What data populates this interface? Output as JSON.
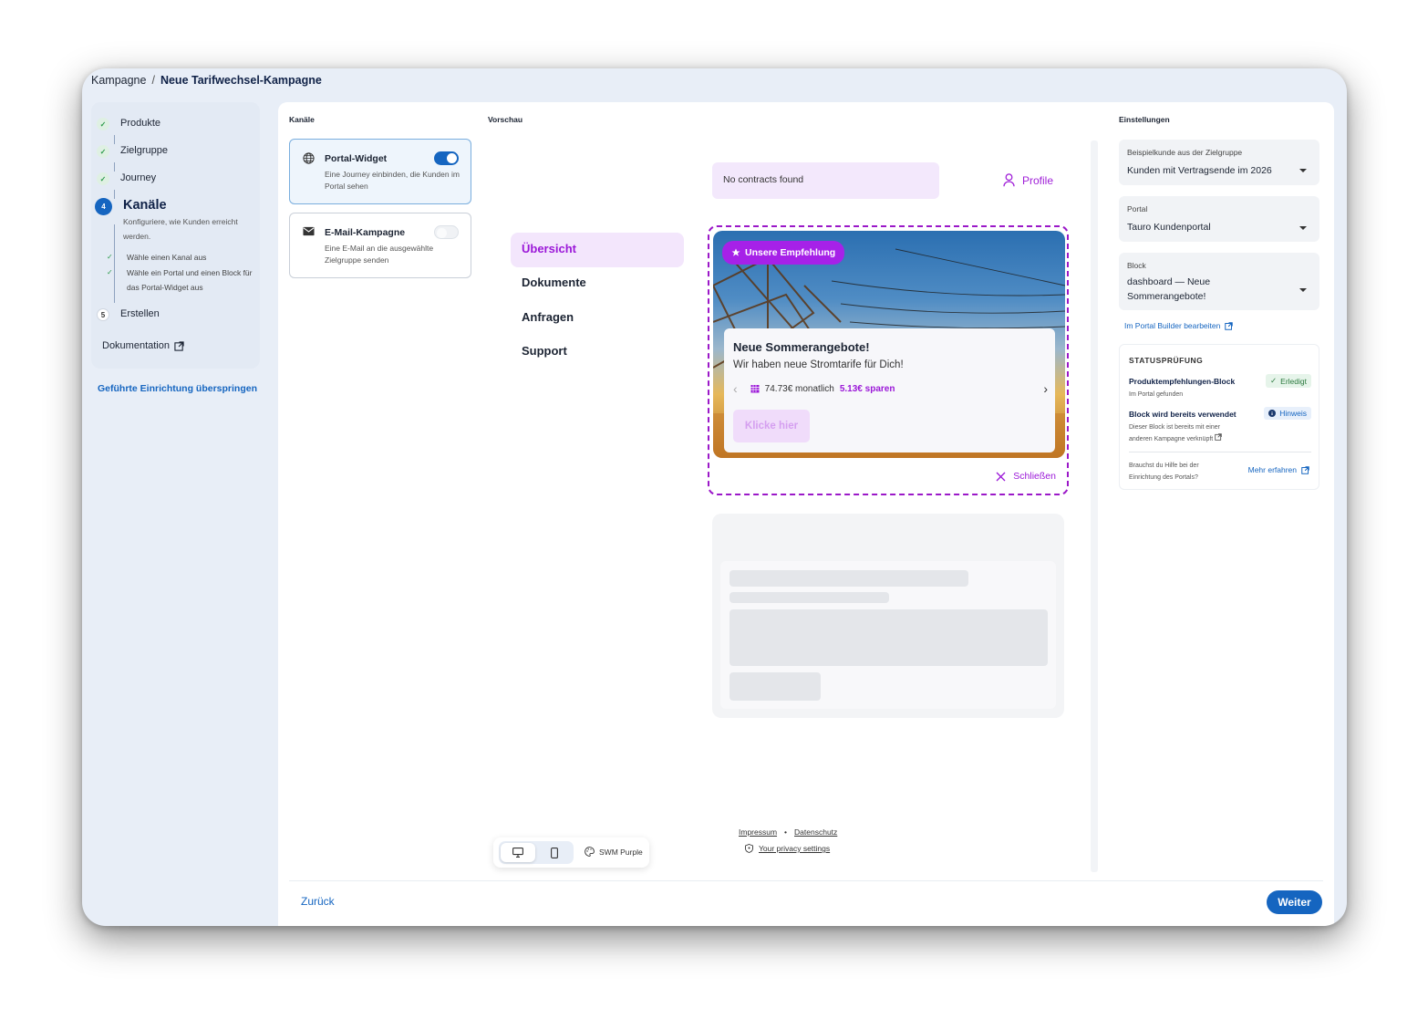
{
  "breadcrumb": {
    "parent": "Kampagne",
    "separator": "/",
    "current": "Neue Tarifwechsel-Kampagne"
  },
  "stepper": {
    "steps": [
      {
        "label": "Produkte"
      },
      {
        "label": "Zielgruppe"
      },
      {
        "label": "Journey"
      },
      {
        "number": "4",
        "label": "Kanäle",
        "description": "Konfiguriere, wie Kunden erreicht werden."
      },
      {
        "number": "5",
        "label": "Erstellen"
      }
    ],
    "substeps": [
      {
        "label": "Wähle einen Kanal aus"
      },
      {
        "label": "Wähle ein Portal und einen Block für das Portal-Widget aus"
      }
    ],
    "documentation": "Dokumentation",
    "skip": "Geführte Einrichtung überspringen"
  },
  "channels": {
    "heading": "Kanäle",
    "items": [
      {
        "title": "Portal-Widget",
        "text": "Eine Journey einbinden, die Kunden im Portal sehen",
        "enabled": true,
        "icon": "globe-icon"
      },
      {
        "title": "E-Mail-Kampagne",
        "text": "Eine E-Mail an die ausgewählte Zielgruppe senden",
        "enabled": false,
        "icon": "mail-icon"
      }
    ]
  },
  "preview": {
    "heading": "Vorschau",
    "contracts": "No contracts found",
    "profile": "Profile",
    "nav": [
      "Übersicht",
      "Dokumente",
      "Anfragen",
      "Support"
    ],
    "widget": {
      "badge": "Unsere Empfehlung",
      "title": "Neue Sommerangebote!",
      "subtitle": "Wir haben neue Stromtarife für Dich!",
      "price": "74.73€ monatlich",
      "saving": "5.13€ sparen",
      "cta": "Klicke hier",
      "close": "Schließen"
    },
    "footer": {
      "impressum": "Impressum",
      "dot": "•",
      "datenschutz": "Datenschutz",
      "privacy": "Your privacy settings"
    },
    "theme": "SWM Purple"
  },
  "settings": {
    "heading": "Einstellungen",
    "customer": {
      "caption": "Beispielkunde aus der Zielgruppe",
      "value": "Kunden mit Vertragsende im 2026"
    },
    "portal": {
      "caption": "Portal",
      "value": "Tauro Kundenportal"
    },
    "block": {
      "caption": "Block",
      "value": "dashboard — Neue Sommerangebote!"
    },
    "builder_link": "Im Portal Builder bearbeiten",
    "status": {
      "title": "STATUSPRÜFUNG",
      "items": [
        {
          "name": "Produktempfehlungen-Block",
          "desc": "Im Portal gefunden",
          "badge": "Erledigt"
        },
        {
          "name": "Block wird bereits verwendet",
          "desc": "Dieser Block ist bereits mit einer anderen Kampagne verknüpft",
          "badge": "Hinweis"
        }
      ],
      "help": "Brauchst du Hilfe bei der Einrichtung des Portals?",
      "more": "Mehr erfahren"
    }
  },
  "footer": {
    "back": "Zurück",
    "next": "Weiter"
  },
  "colors": {
    "primary": "#1565c0",
    "accent": "#a621e8",
    "success": "#2c9b4b"
  }
}
